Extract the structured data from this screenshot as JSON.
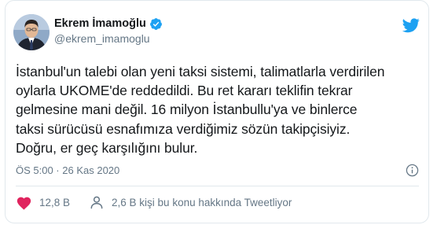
{
  "tweet": {
    "author": {
      "name": "Ekrem İmamoğlu",
      "handle": "@ekrem_imamoglu"
    },
    "text": "İstanbul'un talebi olan yeni taksi sistemi, talimatlarla verdirilen\noylarla UKOME'de reddedildi. Bu ret kararı teklifin tekrar\ngelmesine mani değil. 16 milyon İstanbullu'ya ve binlerce\ntaksi sürücüsü esnafımıza verdiğimiz sözün takipçisiyiz.\nDoğru, er geç karşılığını bulur.",
    "timestamp": "ÖS 5:00 · 26 Kas 2020",
    "likes_label": "12,8 B",
    "discussion_label": "2,6 B kişi bu konu hakkında Tweetliyor"
  },
  "icons": {
    "brand": "twitter-bird-icon",
    "verified": "verified-badge-icon",
    "info": "info-icon",
    "like": "heart-icon",
    "discussion": "person-icon"
  },
  "colors": {
    "twitter_blue": "#1da1f2",
    "like_red": "#e0245e",
    "text_primary": "#14171a",
    "text_secondary": "#657786",
    "border": "#e1e8ed"
  }
}
